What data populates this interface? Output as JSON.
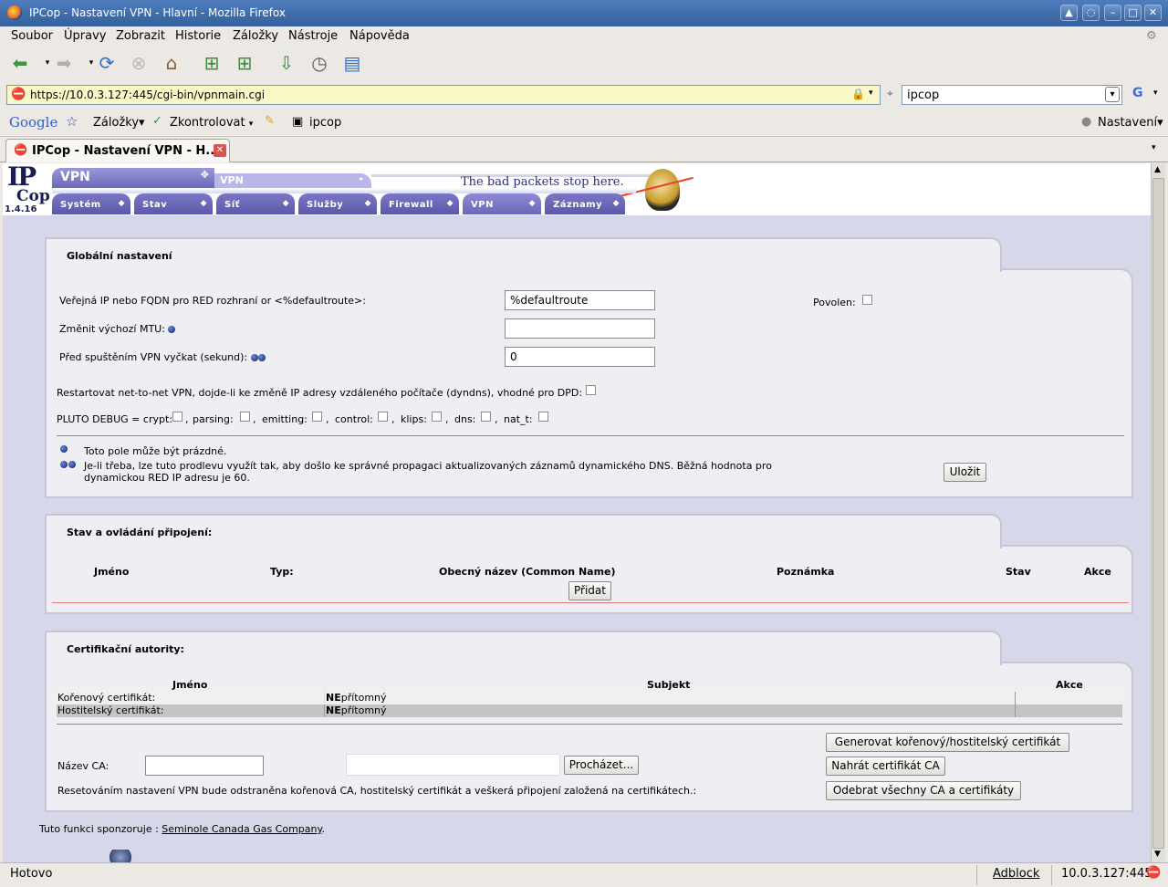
{
  "window": {
    "title": "IPCop - Nastavení VPN - Hlavní - Mozilla Firefox"
  },
  "menu": [
    "Soubor",
    "Úpravy",
    "Zobrazit",
    "Historie",
    "Záložky",
    "Nástroje",
    "Nápověda"
  ],
  "address": {
    "url": "https://10.0.3.127:445/cgi-bin/vpnmain.cgi"
  },
  "search": {
    "value": "ipcop"
  },
  "bookmarks": {
    "google": "Google",
    "zalozky": "Záložky",
    "zkontrolovat": "Zkontrolovat",
    "ipcop": "ipcop",
    "nastaveni": "Nastavení"
  },
  "tab": {
    "label": "IPCop - Nastavení VPN - H..."
  },
  "header": {
    "logo_top": "IP",
    "logo_bottom": "Cop",
    "version": "1.4.16",
    "section": "VPN",
    "subsection": "VPN",
    "slogan": "The bad packets stop here.",
    "nav": [
      "Systém",
      "Stav",
      "Síť",
      "Služby",
      "Firewall",
      "VPN",
      "Záznamy"
    ]
  },
  "global": {
    "title": "Globální nastavení",
    "public_ip_label": "Veřejná IP nebo FQDN pro RED rozhraní or <%defaultroute>:",
    "public_ip_value": "%defaultroute",
    "enabled_label": "Povolen:",
    "mtu_label": "Změnit výchozí MTU:",
    "mtu_value": "",
    "delay_label": "Před spuštěním VPN vyčkat (sekund):",
    "delay_value": "0",
    "restart_label": "Restartovat net-to-net VPN, dojde-li ke změně IP adresy vzdáleného počítače (dyndns), vhodné pro DPD:",
    "debug_label": "PLUTO DEBUG = crypt:",
    "debug_opts": [
      "parsing:",
      "emitting:",
      "control:",
      "klips:",
      "dns:",
      "nat_t:"
    ],
    "note1": "Toto pole může být prázdné.",
    "note2": "Je-li třeba, lze tuto prodlevu využít tak, aby došlo ke správné propagaci aktualizovaných záznamů dynamického DNS. Běžná hodnota pro dynamickou RED IP adresu je 60.",
    "save": "Uložit"
  },
  "connections": {
    "title": "Stav a ovládání připojení:",
    "columns": [
      "Jméno",
      "Typ:",
      "Obecný název (Common Name)",
      "Poznámka",
      "Stav",
      "Akce"
    ],
    "add": "Přidat"
  },
  "ca": {
    "title": "Certifikační autority:",
    "columns": [
      "Jméno",
      "Subjekt",
      "Akce"
    ],
    "rows": [
      {
        "name": "Kořenový certifikát:",
        "status_bold": "NE",
        "status": "přítomný"
      },
      {
        "name": "Hostitelský certifikát:",
        "status_bold": "NE",
        "status": "přítomný"
      }
    ],
    "generate": "Generovat kořenový/hostitelský certifikát",
    "name_label": "Název CA:",
    "name_value": "",
    "browse": "Procházet...",
    "upload": "Nahrát certifikát CA",
    "reset_text": "Resetováním nastavení VPN bude odstraněna kořenová CA, hostitelský certifikát a veškerá připojení založená na certifikátech.:",
    "remove": "Odebrat všechny CA a certifikáty"
  },
  "sponsor": {
    "text": "Tuto funkci sponzoruje :",
    "link": "Seminole Canada Gas Company",
    "period": "."
  },
  "statusbar": {
    "text": "Hotovo",
    "adblock": "Adblock",
    "host": "10.0.3.127:445"
  }
}
